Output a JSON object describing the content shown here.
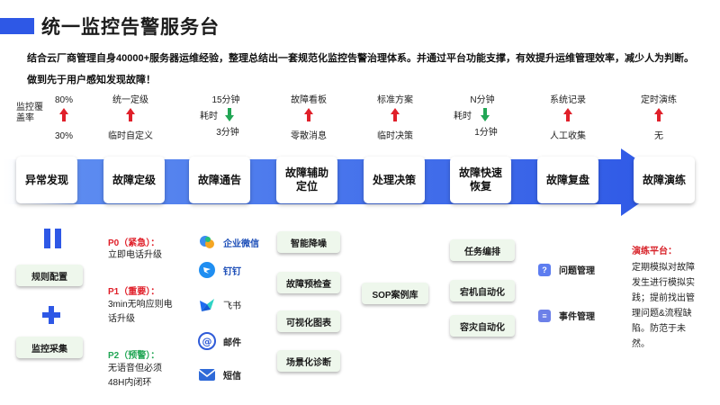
{
  "page": {
    "title": "统一监控告警服务台",
    "intro": "结合云厂商管理自身40000+服务器运维经验，整理总结出一套规范化监控告警治理体系。并通过平台功能支撑，有效提升运维管理效率，减少人为判断。做到先于用户感知发现故障！"
  },
  "metrics": {
    "coverage": {
      "label": "监控覆盖率",
      "before": "80%",
      "after": "30%",
      "trend": "up"
    },
    "grading": {
      "top": "统一定级",
      "bottom": "临时自定义",
      "trend": "up"
    },
    "notify": {
      "top": "15分钟",
      "side": "耗时",
      "bottom": "3分钟",
      "trend": "down"
    },
    "board": {
      "top": "故障看板",
      "bottom": "零散消息",
      "trend": "up"
    },
    "plan": {
      "top": "标准方案",
      "bottom": "临时决策",
      "trend": "up"
    },
    "recover": {
      "top": "N分钟",
      "side": "耗时",
      "bottom": "1分钟",
      "trend": "down"
    },
    "record": {
      "top": "系统记录",
      "bottom": "人工收集",
      "trend": "up"
    },
    "drill": {
      "top": "定时演练",
      "bottom": "无",
      "trend": "up"
    }
  },
  "stages": [
    "异常发现",
    "故障定级",
    "故障通告",
    "故障辅助定位",
    "处理决策",
    "故障快速恢复",
    "故障复盘",
    "故障演练"
  ],
  "discovery": {
    "config": "规则配置",
    "collect": "监控采集"
  },
  "priorities": {
    "p0": {
      "head": "P0（紧急）：",
      "desc": "立即电话升级",
      "color": "#e0202a"
    },
    "p1": {
      "head": "P1（重要）：",
      "desc": "3min无响应则电话升级",
      "color": "#e0202a"
    },
    "p2": {
      "head": "P2（预警）：",
      "desc": "无语音但必须48H内闭环",
      "color": "#22a655"
    }
  },
  "channels": {
    "wecom": {
      "label": "企业微信",
      "icon": "wecom-icon"
    },
    "dingtalk": {
      "label": "钉钉",
      "icon": "dingtalk-icon"
    },
    "feishu": {
      "label": "飞书",
      "icon": "feishu-icon"
    },
    "email": {
      "label": "邮件",
      "icon": "email-icon"
    },
    "sms": {
      "label": "短信",
      "icon": "sms-icon"
    }
  },
  "locate_tools": [
    "智能降噪",
    "故障预检查",
    "可视化图表",
    "场景化诊断"
  ],
  "decision_tool": "SOP案例库",
  "recover_tools": [
    "任务编排",
    "宕机自动化",
    "容灾自动化"
  ],
  "review_tools": {
    "problem": {
      "label": "问题管理",
      "icon": "question-icon"
    },
    "event": {
      "label": "事件管理",
      "icon": "list-icon"
    }
  },
  "drill_panel": {
    "head": "演练平台：",
    "body": "定期模拟对故障发生进行模拟实践；提前找出管理问题&流程缺陷。防范于未然。"
  },
  "colors": {
    "accent": "#2e58e6",
    "up": "#e0202a",
    "down": "#22a655",
    "pill_bg": "#eef7ec"
  }
}
